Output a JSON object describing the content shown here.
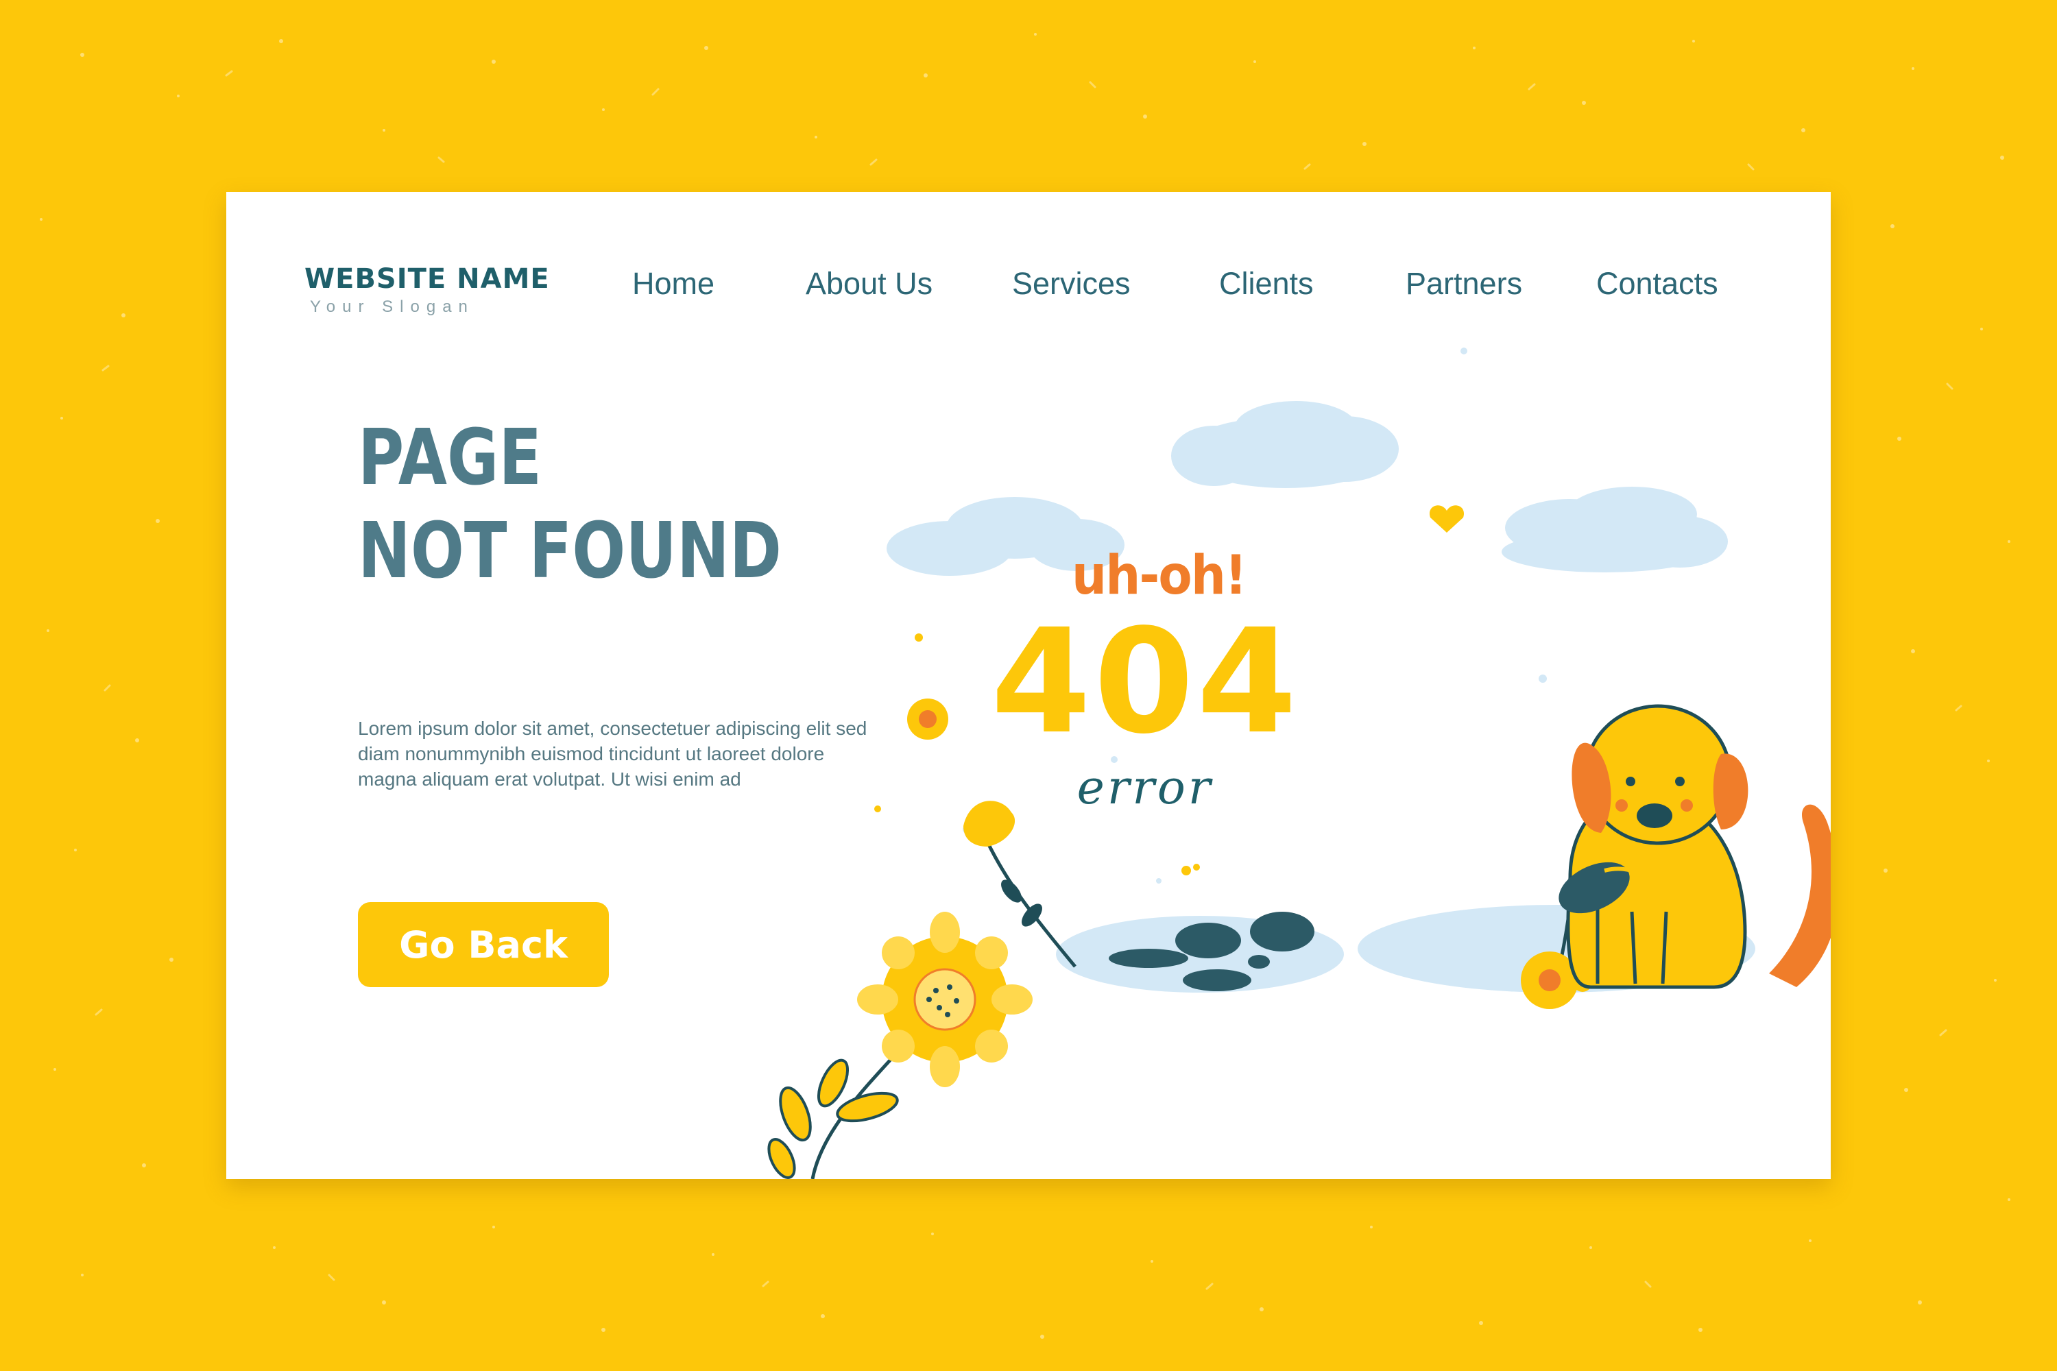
{
  "header": {
    "website_name": "WEBSITE NAME",
    "slogan": "Your Slogan",
    "nav": [
      {
        "label": "Home"
      },
      {
        "label": "About Us"
      },
      {
        "label": "Services"
      },
      {
        "label": "Clients"
      },
      {
        "label": "Partners"
      },
      {
        "label": "Contacts"
      }
    ]
  },
  "hero": {
    "title_line1": "PAGE",
    "title_line2": "NOT FOUND",
    "body": "Lorem ipsum dolor sit amet, consectetuer adipiscing elit sed diam nonummynibh euismod tincidunt ut laoreet dolore magna aliquam erat volutpat. Ut wisi enim ad",
    "button_label": "Go Back"
  },
  "illustration": {
    "exclamation": "uh-oh!",
    "code": "404",
    "word": "error"
  },
  "colors": {
    "background": "#fdc70a",
    "primary_text": "#1f5f6a",
    "heading": "#4f7b89",
    "accent_orange": "#f07d2a",
    "cloud_blue": "#d3e8f6"
  }
}
